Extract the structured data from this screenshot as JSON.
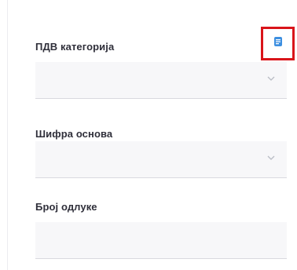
{
  "form": {
    "vat_category": {
      "label": "ПДВ категорија",
      "value": ""
    },
    "basis_code": {
      "label": "Шифра основа",
      "value": ""
    },
    "decision_number": {
      "label": "Број одлуке",
      "value": ""
    }
  },
  "icons": {
    "vat_info": "document-info-icon",
    "dropdown": "chevron-down-icon"
  },
  "colors": {
    "highlight": "#d9141a",
    "icon_blue": "#3d8fe0",
    "field_bg": "#f7f7f9",
    "label": "#2f2f3a"
  }
}
